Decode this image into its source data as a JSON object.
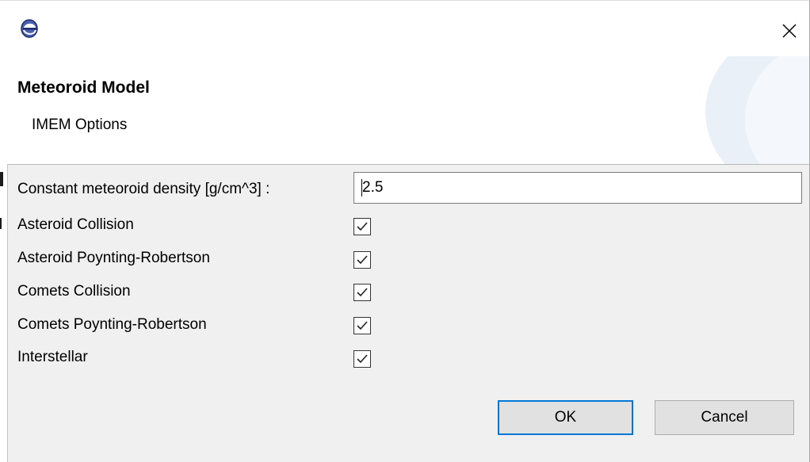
{
  "window": {
    "icon": "eclipse-app-icon",
    "close_icon": "close-icon"
  },
  "header": {
    "title": "Meteoroid Model",
    "subtitle": "IMEM Options"
  },
  "form": {
    "density_label": "Constant meteoroid density [g/cm^3] :",
    "density_value": "2.5",
    "options": [
      {
        "label": "Asteroid Collision",
        "checked": true
      },
      {
        "label": "Asteroid Poynting-Robertson",
        "checked": true
      },
      {
        "label": "Comets Collision",
        "checked": true
      },
      {
        "label": "Comets Poynting-Robertson",
        "checked": true
      },
      {
        "label": "Interstellar",
        "checked": true
      }
    ]
  },
  "buttons": {
    "ok_label": "OK",
    "cancel_label": "Cancel"
  },
  "colors": {
    "accent": "#0078d7",
    "dialog_bg": "#f0f0f0"
  }
}
